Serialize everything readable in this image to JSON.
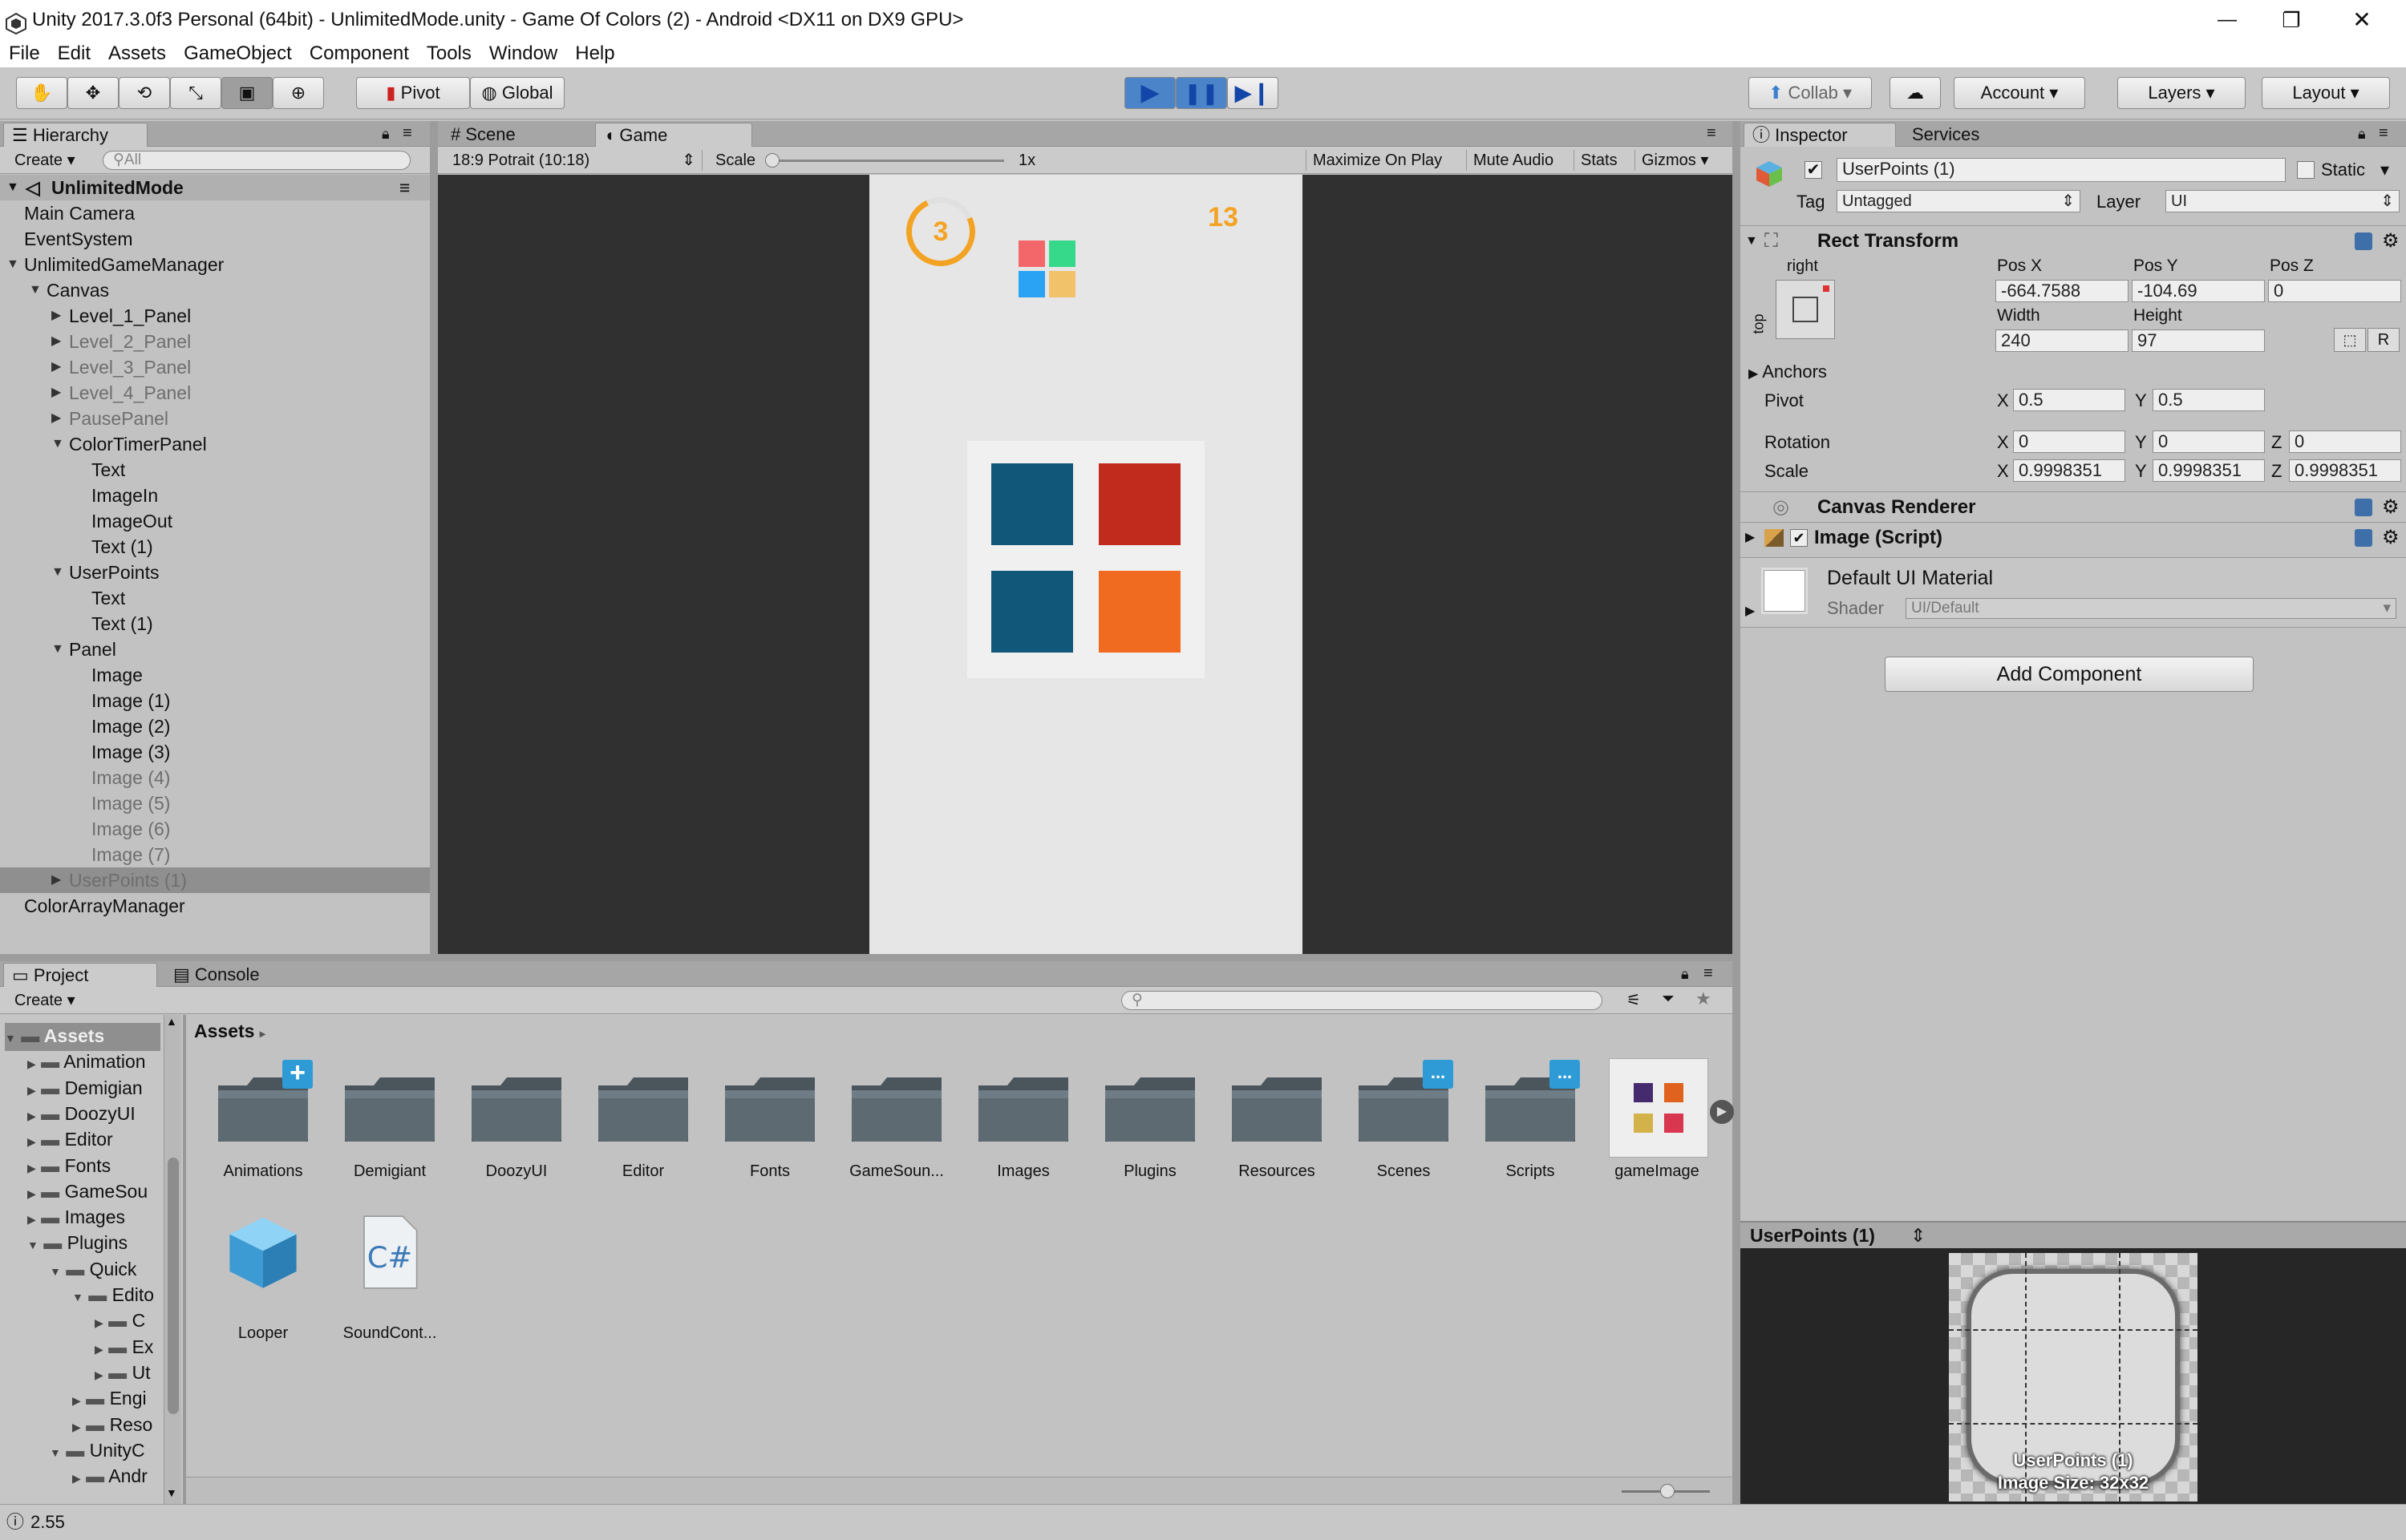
{
  "window": {
    "title": "Unity 2017.3.0f3 Personal (64bit) - UnlimitedMode.unity - Game Of Colors (2) - Android <DX11 on DX9 GPU>",
    "controls": {
      "minimize": "—",
      "restore": "❐",
      "close": "✕"
    }
  },
  "menu": [
    "File",
    "Edit",
    "Assets",
    "GameObject",
    "Component",
    "Tools",
    "Window",
    "Help"
  ],
  "toolbar": {
    "pivot": "Pivot",
    "global": "Global",
    "collab": "Collab",
    "account": "Account",
    "layers": "Layers",
    "layout": "Layout"
  },
  "hierarchy": {
    "tab": "Hierarchy",
    "create": "Create",
    "search_placeholder": "All",
    "scene": "UnlimitedMode",
    "items": [
      {
        "label": "Main Camera",
        "depth": 1,
        "active": true
      },
      {
        "label": "EventSystem",
        "depth": 1,
        "active": true
      },
      {
        "label": "UnlimitedGameManager",
        "depth": 1,
        "active": true,
        "expanded": true
      },
      {
        "label": "Canvas",
        "depth": 2,
        "active": true,
        "expanded": true
      },
      {
        "label": "Level_1_Panel",
        "depth": 3,
        "active": true,
        "collapsed": true
      },
      {
        "label": "Level_2_Panel",
        "depth": 3,
        "active": false,
        "collapsed": true
      },
      {
        "label": "Level_3_Panel",
        "depth": 3,
        "active": false,
        "collapsed": true
      },
      {
        "label": "Level_4_Panel",
        "depth": 3,
        "active": false,
        "collapsed": true
      },
      {
        "label": "PausePanel",
        "depth": 3,
        "active": false,
        "collapsed": true
      },
      {
        "label": "ColorTimerPanel",
        "depth": 3,
        "active": true,
        "expanded": true
      },
      {
        "label": "Text",
        "depth": 4,
        "active": true
      },
      {
        "label": "ImageIn",
        "depth": 4,
        "active": true
      },
      {
        "label": "ImageOut",
        "depth": 4,
        "active": true
      },
      {
        "label": "Text (1)",
        "depth": 4,
        "active": true
      },
      {
        "label": "UserPoints",
        "depth": 3,
        "active": true,
        "expanded": true
      },
      {
        "label": "Text",
        "depth": 4,
        "active": true
      },
      {
        "label": "Text (1)",
        "depth": 4,
        "active": true
      },
      {
        "label": "Panel",
        "depth": 3,
        "active": true,
        "expanded": true
      },
      {
        "label": "Image",
        "depth": 4,
        "active": true
      },
      {
        "label": "Image (1)",
        "depth": 4,
        "active": true
      },
      {
        "label": "Image (2)",
        "depth": 4,
        "active": true
      },
      {
        "label": "Image (3)",
        "depth": 4,
        "active": true
      },
      {
        "label": "Image (4)",
        "depth": 4,
        "active": false
      },
      {
        "label": "Image (5)",
        "depth": 4,
        "active": false
      },
      {
        "label": "Image (6)",
        "depth": 4,
        "active": false
      },
      {
        "label": "Image (7)",
        "depth": 4,
        "active": false
      },
      {
        "label": "UserPoints (1)",
        "depth": 3,
        "active": false,
        "selected": true,
        "collapsed": true
      },
      {
        "label": "ColorArrayManager",
        "depth": 1,
        "active": true
      }
    ]
  },
  "scene_tabs": {
    "scene": "Scene",
    "game": "Game"
  },
  "game_bar": {
    "aspect": "18:9 Potrait (10:18)",
    "scale_label": "Scale",
    "scale_value": "1x",
    "maximize": "Maximize On Play",
    "mute": "Mute Audio",
    "stats": "Stats",
    "gizmos": "Gizmos"
  },
  "game_view": {
    "timer": "3",
    "score": "13",
    "mini_colors": [
      "#f3676a",
      "#36d98a",
      "#2aa3f5",
      "#f2c26b"
    ],
    "tile_colors": [
      "#10577a",
      "#c12b1e",
      "#10577a",
      "#f06a1f"
    ]
  },
  "project": {
    "tab_project": "Project",
    "tab_console": "Console",
    "create": "Create",
    "breadcrumb": "Assets",
    "tree": [
      {
        "label": "Assets",
        "depth": 0
      },
      {
        "label": "Animation",
        "depth": 1
      },
      {
        "label": "Demigian",
        "depth": 1
      },
      {
        "label": "DoozyUI",
        "depth": 1
      },
      {
        "label": "Editor",
        "depth": 1
      },
      {
        "label": "Fonts",
        "depth": 1
      },
      {
        "label": "GameSou",
        "depth": 1
      },
      {
        "label": "Images",
        "depth": 1
      },
      {
        "label": "Plugins",
        "depth": 1
      },
      {
        "label": "Quick",
        "depth": 2
      },
      {
        "label": "Edito",
        "depth": 3
      },
      {
        "label": "C",
        "depth": 4
      },
      {
        "label": "Ex",
        "depth": 4
      },
      {
        "label": "Ut",
        "depth": 4
      },
      {
        "label": "Engi",
        "depth": 3
      },
      {
        "label": "Reso",
        "depth": 3
      },
      {
        "label": "UnityC",
        "depth": 2
      },
      {
        "label": "Andr",
        "depth": 3
      }
    ],
    "assets": [
      {
        "label": "Animations",
        "kind": "folder",
        "badge": "+"
      },
      {
        "label": "Demigiant",
        "kind": "folder"
      },
      {
        "label": "DoozyUI",
        "kind": "folder"
      },
      {
        "label": "Editor",
        "kind": "folder"
      },
      {
        "label": "Fonts",
        "kind": "folder"
      },
      {
        "label": "GameSoun...",
        "kind": "folder"
      },
      {
        "label": "Images",
        "kind": "folder"
      },
      {
        "label": "Plugins",
        "kind": "folder"
      },
      {
        "label": "Resources",
        "kind": "folder"
      },
      {
        "label": "Scenes",
        "kind": "folder",
        "badge": "..."
      },
      {
        "label": "Scripts",
        "kind": "folder",
        "badge": "..."
      },
      {
        "label": "gameImage",
        "kind": "image"
      },
      {
        "label": "Looper",
        "kind": "prefab"
      },
      {
        "label": "SoundCont...",
        "kind": "script"
      }
    ]
  },
  "inspector": {
    "tab": "Inspector",
    "tab_services": "Services",
    "object_name": "UserPoints (1)",
    "static_label": "Static",
    "tag_label": "Tag",
    "tag_value": "Untagged",
    "layer_label": "Layer",
    "layer_value": "UI",
    "rect_transform": {
      "title": "Rect Transform",
      "anchor_h": "right",
      "anchor_v": "top",
      "posx_label": "Pos X",
      "posx": "-664.7588",
      "posy_label": "Pos Y",
      "posy": "-104.69",
      "posz_label": "Pos Z",
      "posz": "0",
      "width_label": "Width",
      "width": "240",
      "height_label": "Height",
      "height": "97",
      "r_button": "R",
      "anchors": "Anchors",
      "pivot": "Pivot",
      "pivot_x": "0.5",
      "pivot_y": "0.5",
      "rotation": "Rotation",
      "rot_x": "0",
      "rot_y": "0",
      "rot_z": "0",
      "scale": "Scale",
      "scale_x": "0.9998351",
      "scale_y": "0.9998351",
      "scale_z": "0.9998351",
      "x": "X",
      "y": "Y",
      "z": "Z"
    },
    "canvas_renderer": "Canvas Renderer",
    "image_script": "Image (Script)",
    "material": "Default UI Material",
    "shader_label": "Shader",
    "shader_value": "UI/Default",
    "add_component": "Add Component"
  },
  "preview": {
    "title": "UserPoints (1)",
    "caption_name": "UserPoints (1)",
    "caption_size": "Image Size: 32x32"
  },
  "status": {
    "text": "2.55"
  }
}
